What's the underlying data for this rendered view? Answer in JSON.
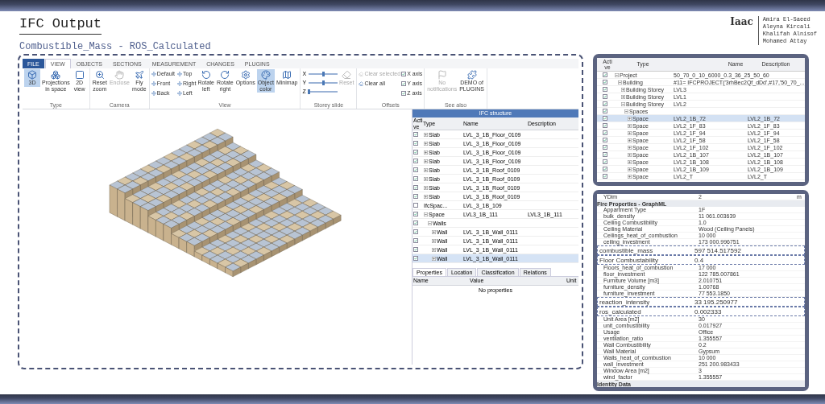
{
  "header": {
    "title": "IFC Output",
    "subtitle": "Combustible_Mass - ROS_Calculated",
    "logo": "Iaac",
    "authors": [
      "Amira El-Saeed",
      "Aleyna Kircali",
      "Khalifah Alnisof",
      "Mohamed Attay"
    ]
  },
  "viewer": {
    "ribbon_tabs": [
      {
        "label": "FILE",
        "kind": "file",
        "selected": false
      },
      {
        "label": "VIEW",
        "kind": "tab",
        "selected": true
      },
      {
        "label": "OBJECTS",
        "kind": "tab",
        "selected": false
      },
      {
        "label": "SECTIONS",
        "kind": "tab",
        "selected": false
      },
      {
        "label": "MEASUREMENT",
        "kind": "tab",
        "selected": false
      },
      {
        "label": "CHANGES",
        "kind": "tab",
        "selected": false
      },
      {
        "label": "PLUGINS",
        "kind": "tab",
        "selected": false
      }
    ],
    "ribbon_groups": [
      {
        "label": "Type",
        "items": [
          {
            "kind": "button",
            "label": "3D",
            "selected": true,
            "disabled": false
          },
          {
            "kind": "button",
            "label": "Projections in space",
            "selected": false,
            "disabled": false
          },
          {
            "kind": "button",
            "label": "2D view",
            "selected": false,
            "disabled": false
          }
        ]
      },
      {
        "label": "Camera",
        "items": [
          {
            "kind": "button",
            "label": "Reset zoom",
            "selected": false,
            "disabled": false
          },
          {
            "kind": "button",
            "label": "Enclose",
            "selected": false,
            "disabled": true
          },
          {
            "kind": "button",
            "label": "Fly mode",
            "selected": false,
            "disabled": false
          }
        ]
      },
      {
        "label": "View",
        "items": [
          {
            "kind": "small",
            "label": "Default",
            "selected": false,
            "disabled": false
          },
          {
            "kind": "small",
            "label": "Front",
            "selected": false,
            "disabled": false
          },
          {
            "kind": "small",
            "label": "Back",
            "selected": false,
            "disabled": false
          },
          {
            "kind": "small",
            "label": "Top",
            "selected": false,
            "disabled": false
          },
          {
            "kind": "small",
            "label": "Right",
            "selected": false,
            "disabled": false
          },
          {
            "kind": "small",
            "label": "Left",
            "selected": false,
            "disabled": false
          },
          {
            "kind": "button",
            "label": "Rotate left",
            "selected": false,
            "disabled": false
          },
          {
            "kind": "button",
            "label": "Rotate right",
            "selected": false,
            "disabled": false
          },
          {
            "kind": "button",
            "label": "Options",
            "selected": false,
            "disabled": false
          },
          {
            "kind": "button",
            "label": "Object color",
            "selected": true,
            "disabled": false
          },
          {
            "kind": "button",
            "label": "Minimap",
            "selected": false,
            "disabled": false
          }
        ]
      },
      {
        "label": "Storey slide",
        "items": [
          {
            "kind": "slider",
            "label": "X",
            "level": 0.5
          },
          {
            "kind": "slider",
            "label": "Y",
            "level": 0.5
          },
          {
            "kind": "slider",
            "label": "Z",
            "level": 0.0
          },
          {
            "kind": "button",
            "label": "Reset",
            "selected": false,
            "disabled": true
          }
        ]
      },
      {
        "label": "Offsets",
        "items": [
          {
            "kind": "small",
            "label": "Clear selected",
            "selected": false,
            "disabled": true
          },
          {
            "kind": "small",
            "label": "Clear all",
            "selected": false,
            "disabled": false
          },
          {
            "kind": "checkbox",
            "label": "X axis",
            "checked": true
          },
          {
            "kind": "checkbox",
            "label": "Y axis",
            "checked": true
          },
          {
            "kind": "checkbox",
            "label": "Z axis",
            "checked": true
          }
        ]
      },
      {
        "label": "See also",
        "items": [
          {
            "kind": "button",
            "label": "No notifications",
            "selected": false,
            "disabled": true
          },
          {
            "kind": "button",
            "label": "DEMO of PLUGINS",
            "selected": false,
            "disabled": false
          }
        ]
      }
    ],
    "structure_panel": {
      "title": "IFC structure",
      "columns": [
        "Acti ve",
        "Type",
        "Name",
        "Description"
      ],
      "rows": [
        {
          "type": "Slab",
          "name": "LVL_3_1B_Floor_0109",
          "checked": true,
          "selected": false,
          "expanded": false
        },
        {
          "type": "Slab",
          "name": "LVL_3_1B_Floor_0109",
          "checked": true,
          "selected": false,
          "expanded": false
        },
        {
          "type": "Slab",
          "name": "LVL_3_1B_Floor_0109",
          "checked": true,
          "selected": false,
          "expanded": false
        },
        {
          "type": "Slab",
          "name": "LVL_3_1B_Floor_0109",
          "checked": true,
          "selected": false,
          "expanded": false
        },
        {
          "type": "Slab",
          "name": "LVL_3_1B_Roof_0109",
          "checked": true,
          "selected": false,
          "expanded": false
        },
        {
          "type": "Slab",
          "name": "LVL_3_1B_Roof_0109",
          "checked": true,
          "selected": false,
          "expanded": false
        },
        {
          "type": "Slab",
          "name": "LVL_3_1B_Roof_0109",
          "checked": true,
          "selected": false,
          "expanded": false
        },
        {
          "type": "Slab",
          "name": "LVL_3_1B_Roof_0109",
          "checked": true,
          "selected": false,
          "expanded": false
        },
        {
          "type": "IfcSpac...",
          "name": "LVL_3_1B_109",
          "checked": false,
          "selected": false
        },
        {
          "type": "Space",
          "name": "LVL3_1B_111",
          "description": "LVL3_1B_111",
          "checked": true,
          "selected": false,
          "expanded": true,
          "children": [
            {
              "type": "Walls",
              "checked": true,
              "selected": false,
              "expanded": true,
              "children": [
                {
                  "type": "Wall",
                  "name": "LVL_3_1B_Wall_0111",
                  "checked": true,
                  "selected": false,
                  "expanded": false
                },
                {
                  "type": "Wall",
                  "name": "LVL_3_1B_Wall_0111",
                  "checked": true,
                  "selected": false,
                  "expanded": false
                },
                {
                  "type": "Wall",
                  "name": "LVL_3_1B_Wall_0111",
                  "checked": true,
                  "selected": false,
                  "expanded": false
                },
                {
                  "type": "Wall",
                  "name": "LVL_3_1B_Wall_0111",
                  "checked": true,
                  "selected": true,
                  "expanded": false
                }
              ]
            }
          ]
        }
      ],
      "tabs": [
        {
          "label": "Properties",
          "selected": true
        },
        {
          "label": "Location",
          "selected": false
        },
        {
          "label": "Classification",
          "selected": false
        },
        {
          "label": "Relations",
          "selected": false
        }
      ],
      "property_columns": [
        "Name",
        "Value",
        "Unit"
      ],
      "empty_text": "No properties"
    }
  },
  "structure_table": {
    "columns": [
      "Acti ve",
      "Type",
      "Name",
      "Description"
    ],
    "rows": [
      {
        "type": "Project",
        "name": "50_70_0_10_6000_0.3_36_25_50_60",
        "checked": true,
        "selected": false,
        "expanded": true,
        "children": [
          {
            "type": "Building",
            "name": "#11= IFCPROJECT('3rhBec2Qf_dDd',#17,'50_70_...",
            "checked": true,
            "selected": false,
            "expanded": true,
            "children": [
              {
                "type": "Building Storey",
                "name": "LVL3",
                "checked": true,
                "selected": false,
                "expanded": false
              },
              {
                "type": "Building Storey",
                "name": "LVL1",
                "checked": true,
                "selected": false,
                "expanded": false
              },
              {
                "type": "Building Storey",
                "name": "LVL2",
                "checked": true,
                "selected": false,
                "expanded": true,
                "children": [
                  {
                    "type": "Spaces",
                    "checked": true,
                    "selected": false,
                    "expanded": true,
                    "children": [
                      {
                        "type": "Space",
                        "name": "LVL2_1B_72",
                        "description": "LVL2_1B_72",
                        "checked": true,
                        "selected": true,
                        "expanded": false
                      },
                      {
                        "type": "Space",
                        "name": "LVL2_1F_83",
                        "description": "LVL2_1F_83",
                        "checked": true,
                        "selected": false,
                        "expanded": false
                      },
                      {
                        "type": "Space",
                        "name": "LVL2_1F_94",
                        "description": "LVL2_1F_94",
                        "checked": true,
                        "selected": false,
                        "expanded": false
                      },
                      {
                        "type": "Space",
                        "name": "LVL2_1F_58",
                        "description": "LVL2_1F_58",
                        "checked": true,
                        "selected": false,
                        "expanded": false
                      },
                      {
                        "type": "Space",
                        "name": "LVL2_1F_102",
                        "description": "LVL2_1F_102",
                        "checked": true,
                        "selected": false,
                        "expanded": false
                      },
                      {
                        "type": "Space",
                        "name": "LVL2_1B_107",
                        "description": "LVL2_1B_107",
                        "checked": true,
                        "selected": false,
                        "expanded": false
                      },
                      {
                        "type": "Space",
                        "name": "LVL2_1B_108",
                        "description": "LVL2_1B_108",
                        "checked": true,
                        "selected": false,
                        "expanded": false
                      },
                      {
                        "type": "Space",
                        "name": "LVL2_1B_109",
                        "description": "LVL2_1B_109",
                        "checked": true,
                        "selected": false,
                        "expanded": false
                      },
                      {
                        "type": "Space",
                        "name": "LVL2_T",
                        "description": "LVL2_T",
                        "checked": true,
                        "selected": false,
                        "expanded": false
                      }
                    ]
                  }
                ]
              }
            ]
          }
        ]
      }
    ]
  },
  "properties": [
    {
      "kind": "row",
      "label": "YDim",
      "value": "2",
      "unit": "m"
    },
    {
      "kind": "section",
      "label": "Fire Properties - GraphML"
    },
    {
      "kind": "row",
      "label": "Appartment Type",
      "value": "1F"
    },
    {
      "kind": "row",
      "label": "bulk_density",
      "value": "11 061.003639"
    },
    {
      "kind": "row",
      "label": "Ceiling Combustibility",
      "value": "1.0"
    },
    {
      "kind": "row",
      "label": "Ceiling Material",
      "value": "Wood (Ceiling Panels)"
    },
    {
      "kind": "row",
      "label": "Ceilings_heat_of_combustion",
      "value": "10 000"
    },
    {
      "kind": "row",
      "label": "ceiling_investment",
      "value": "173 000.996751"
    },
    {
      "kind": "highlight",
      "label": "combustible_mass",
      "value": "597 514.517592"
    },
    {
      "kind": "highlight",
      "label": "Floor Combustability",
      "value": "0.4"
    },
    {
      "kind": "row",
      "label": "Floors_heat_of_combustion",
      "value": "17 000"
    },
    {
      "kind": "row",
      "label": "floor_investment",
      "value": "122 785.007861"
    },
    {
      "kind": "row",
      "label": "Furniture Volume [m3]",
      "value": "2.010751"
    },
    {
      "kind": "row",
      "label": "furniture_density",
      "value": "1.00768"
    },
    {
      "kind": "row",
      "label": "furniture_investment",
      "value": "77 553.1850"
    },
    {
      "kind": "highlight",
      "label": "reaction_intensity",
      "value": "33 195.250977"
    },
    {
      "kind": "highlight",
      "label": "ros_calculated",
      "value": "0.002333"
    },
    {
      "kind": "row",
      "label": "Unit Area [m2]",
      "value": "30"
    },
    {
      "kind": "row",
      "label": "unit_combustibility",
      "value": "0.017927"
    },
    {
      "kind": "row",
      "label": "Usage",
      "value": "Office"
    },
    {
      "kind": "row",
      "label": "ventilation_ratio",
      "value": "1.355557"
    },
    {
      "kind": "row",
      "label": "Wall Combustibility",
      "value": "0.2"
    },
    {
      "kind": "row",
      "label": "Wall Material",
      "value": "Gypsum"
    },
    {
      "kind": "row",
      "label": "Walls_heat_of_combustion",
      "value": "10 000"
    },
    {
      "kind": "row",
      "label": "wall_investment",
      "value": "251 200.983433"
    },
    {
      "kind": "row",
      "label": "Window Area [m2]",
      "value": "3"
    },
    {
      "kind": "row",
      "label": "wind_factor",
      "value": "1.355557"
    },
    {
      "kind": "section",
      "label": "Identity Data"
    }
  ]
}
